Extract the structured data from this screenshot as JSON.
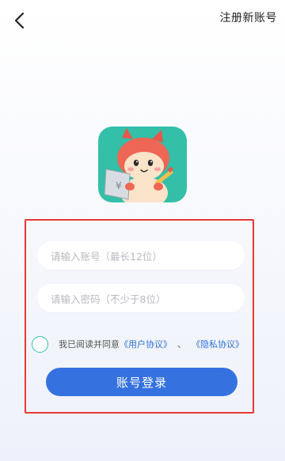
{
  "header": {
    "back_icon": "chevron-left-icon",
    "register_label": "注册新账号"
  },
  "logo": {
    "icon": "squirrel-mascot-app-icon",
    "background_color": "#33bfa8"
  },
  "form": {
    "account_placeholder": "请输入账号（最长12位）",
    "password_placeholder": "请输入密码（不少于8位）",
    "agreement": {
      "prefix": "我已阅读并同意",
      "user_agreement": "《用户协议》",
      "separator": "、",
      "privacy_policy": "《隐私协议》"
    },
    "login_label": "账号登录"
  },
  "colors": {
    "accent": "#3572e0",
    "link": "#2f6fd6",
    "radio": "#33bfa8",
    "highlight_border": "#e53935"
  }
}
